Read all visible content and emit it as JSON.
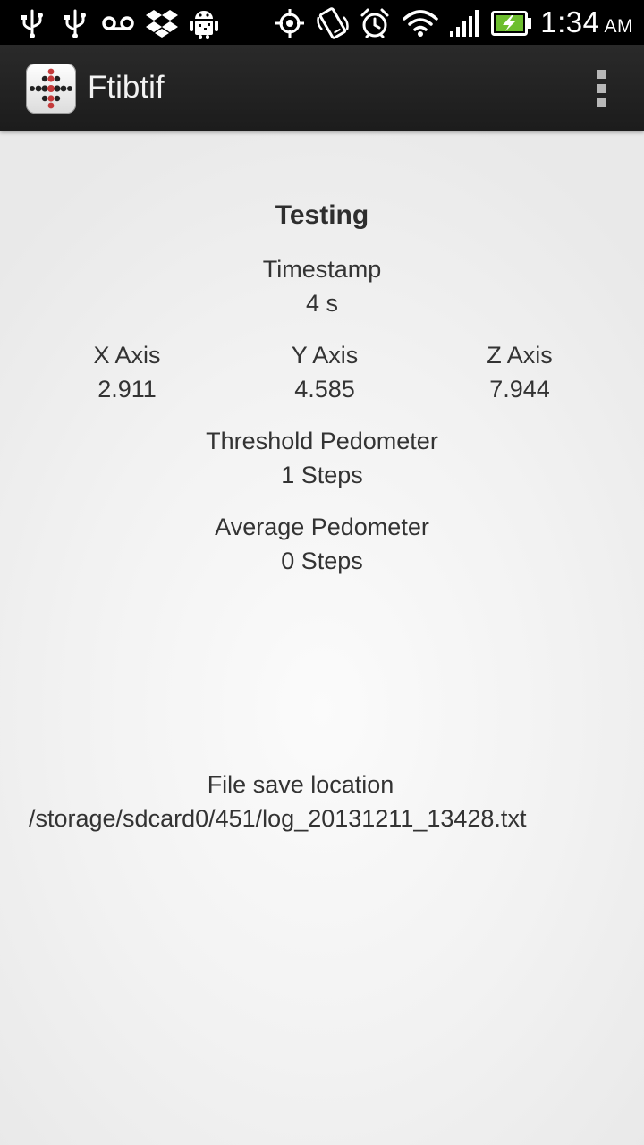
{
  "status_bar": {
    "icons": [
      "usb-icon",
      "usb-icon",
      "voicemail-icon",
      "dropbox-icon",
      "android-debug-icon",
      "gps-icon",
      "rotate-icon",
      "alarm-icon",
      "wifi-icon",
      "signal-icon",
      "battery-charging-icon"
    ],
    "time": "1:34",
    "ampm": "AM"
  },
  "action_bar": {
    "title": "Ftibtif",
    "logo_icon": "fitbit-dots-icon",
    "menu_icon": "overflow-menu-icon"
  },
  "main": {
    "heading": "Testing",
    "timestamp": {
      "label": "Timestamp",
      "value": "4 s"
    },
    "axes": [
      {
        "label": "X Axis",
        "value": "2.911"
      },
      {
        "label": "Y Axis",
        "value": "4.585"
      },
      {
        "label": "Z Axis",
        "value": "7.944"
      }
    ],
    "threshold_pedometer": {
      "label": "Threshold Pedometer",
      "value": "1 Steps"
    },
    "average_pedometer": {
      "label": "Average Pedometer",
      "value": "0 Steps"
    },
    "file_save": {
      "label": "File save location",
      "path": "/storage/sdcard0/451/log_20131211_13428.txt"
    }
  },
  "colors": {
    "status_bar_bg": "#000000",
    "action_bar_bg": "#222222",
    "text": "#333333",
    "battery_green": "#6dbe2e"
  }
}
